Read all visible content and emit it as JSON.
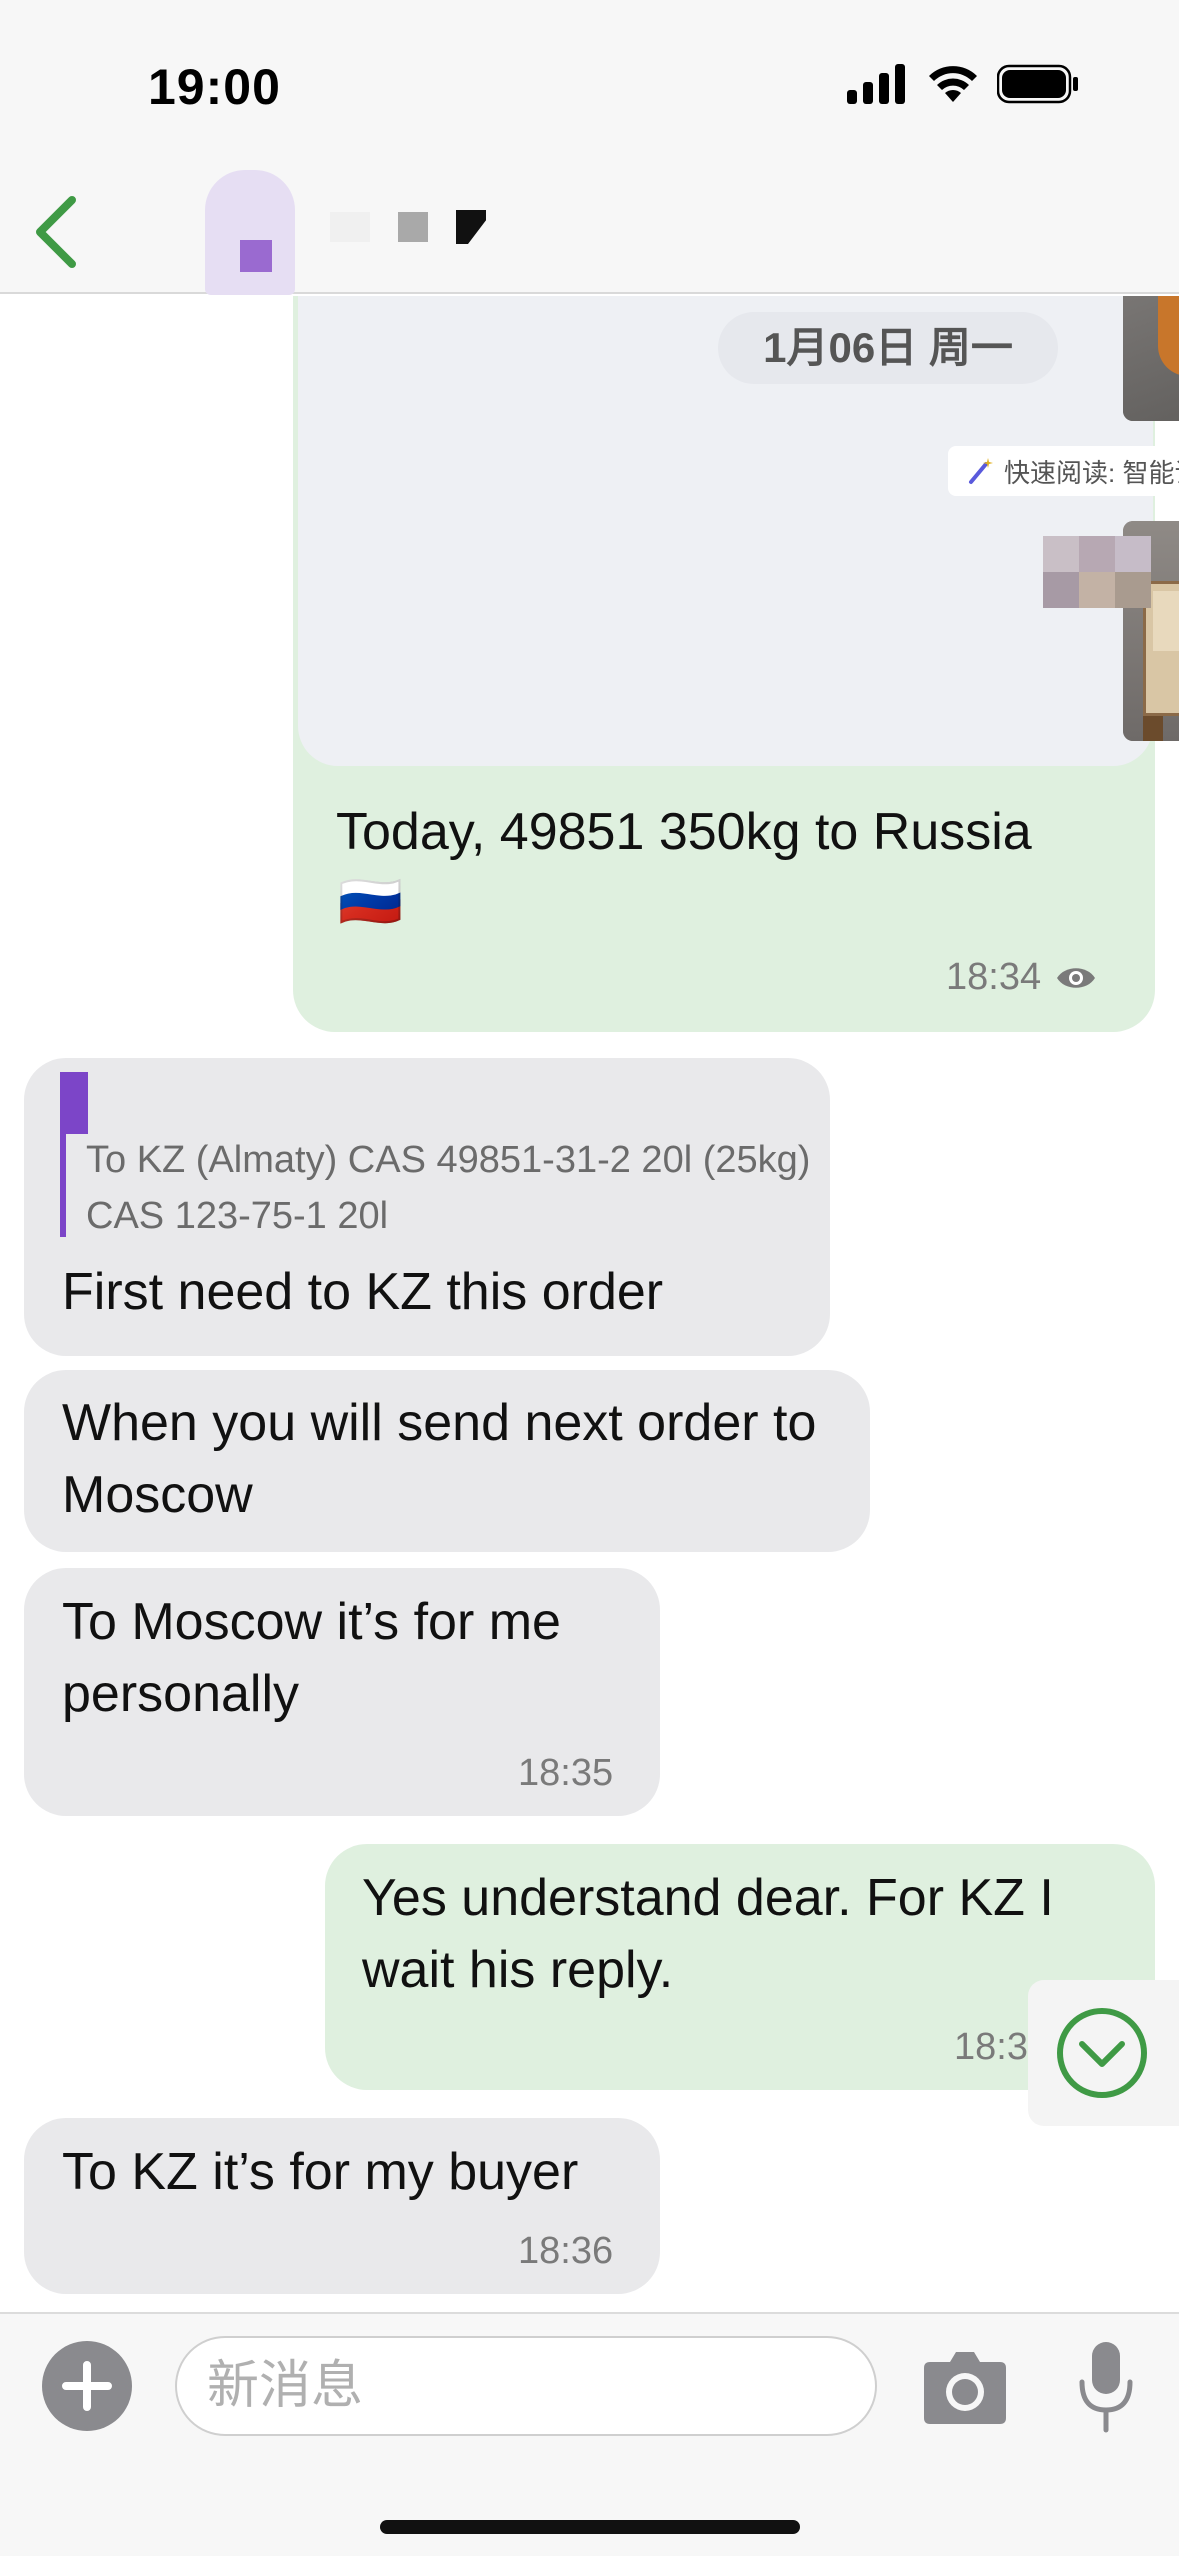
{
  "status_bar": {
    "time": "19:00"
  },
  "nav": {
    "back_icon": "chevron-left-icon"
  },
  "chat": {
    "date_pill": "1月06日 周一",
    "ocr_hint": "快速阅读: 智能识别图片 >",
    "messages": [
      {
        "id": "m1",
        "dir": "out",
        "text": "Today, 49851 350kg to Russia",
        "emoji": "🇷🇺",
        "time": "18:34"
      },
      {
        "id": "m2",
        "dir": "in",
        "quote": "To KZ (Almaty) CAS 49851-31-2 20l (25kg) CAS 123-75-1 20l",
        "text": "First need to KZ this order"
      },
      {
        "id": "m3",
        "dir": "in",
        "text": "When you will send next order to Moscow"
      },
      {
        "id": "m4",
        "dir": "in",
        "text": "To Moscow it’s for me personally",
        "time": "18:35"
      },
      {
        "id": "m5",
        "dir": "out",
        "text": "Yes understand dear. For KZ I wait his reply.",
        "time": "18:35"
      },
      {
        "id": "m6",
        "dir": "in",
        "text": "To KZ it’s for my buyer",
        "time": "18:36"
      }
    ]
  },
  "input": {
    "placeholder": "新消息"
  },
  "colors": {
    "accent_green": "#3f9a45",
    "quote_purple": "#7c45c8",
    "out_bubble": "#dff0df",
    "in_bubble": "#e9e9eb"
  }
}
